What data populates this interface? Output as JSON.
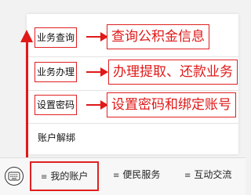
{
  "menu": {
    "items": [
      {
        "label": "业务查询"
      },
      {
        "label": "业务办理"
      },
      {
        "label": "设置密码"
      },
      {
        "label": "账户解绑"
      }
    ]
  },
  "annotations": {
    "query": "查询公积金信息",
    "handle": "办理提取、还款业务",
    "password": "设置密码和绑定账号"
  },
  "bottom_bar": {
    "tabs": [
      {
        "label": "我的账户",
        "icon": "menu-icon"
      },
      {
        "label": "便民服务",
        "icon": "menu-icon"
      },
      {
        "label": "互动交流",
        "icon": "menu-icon"
      }
    ]
  },
  "colors": {
    "annotation_red": "#e01818"
  }
}
